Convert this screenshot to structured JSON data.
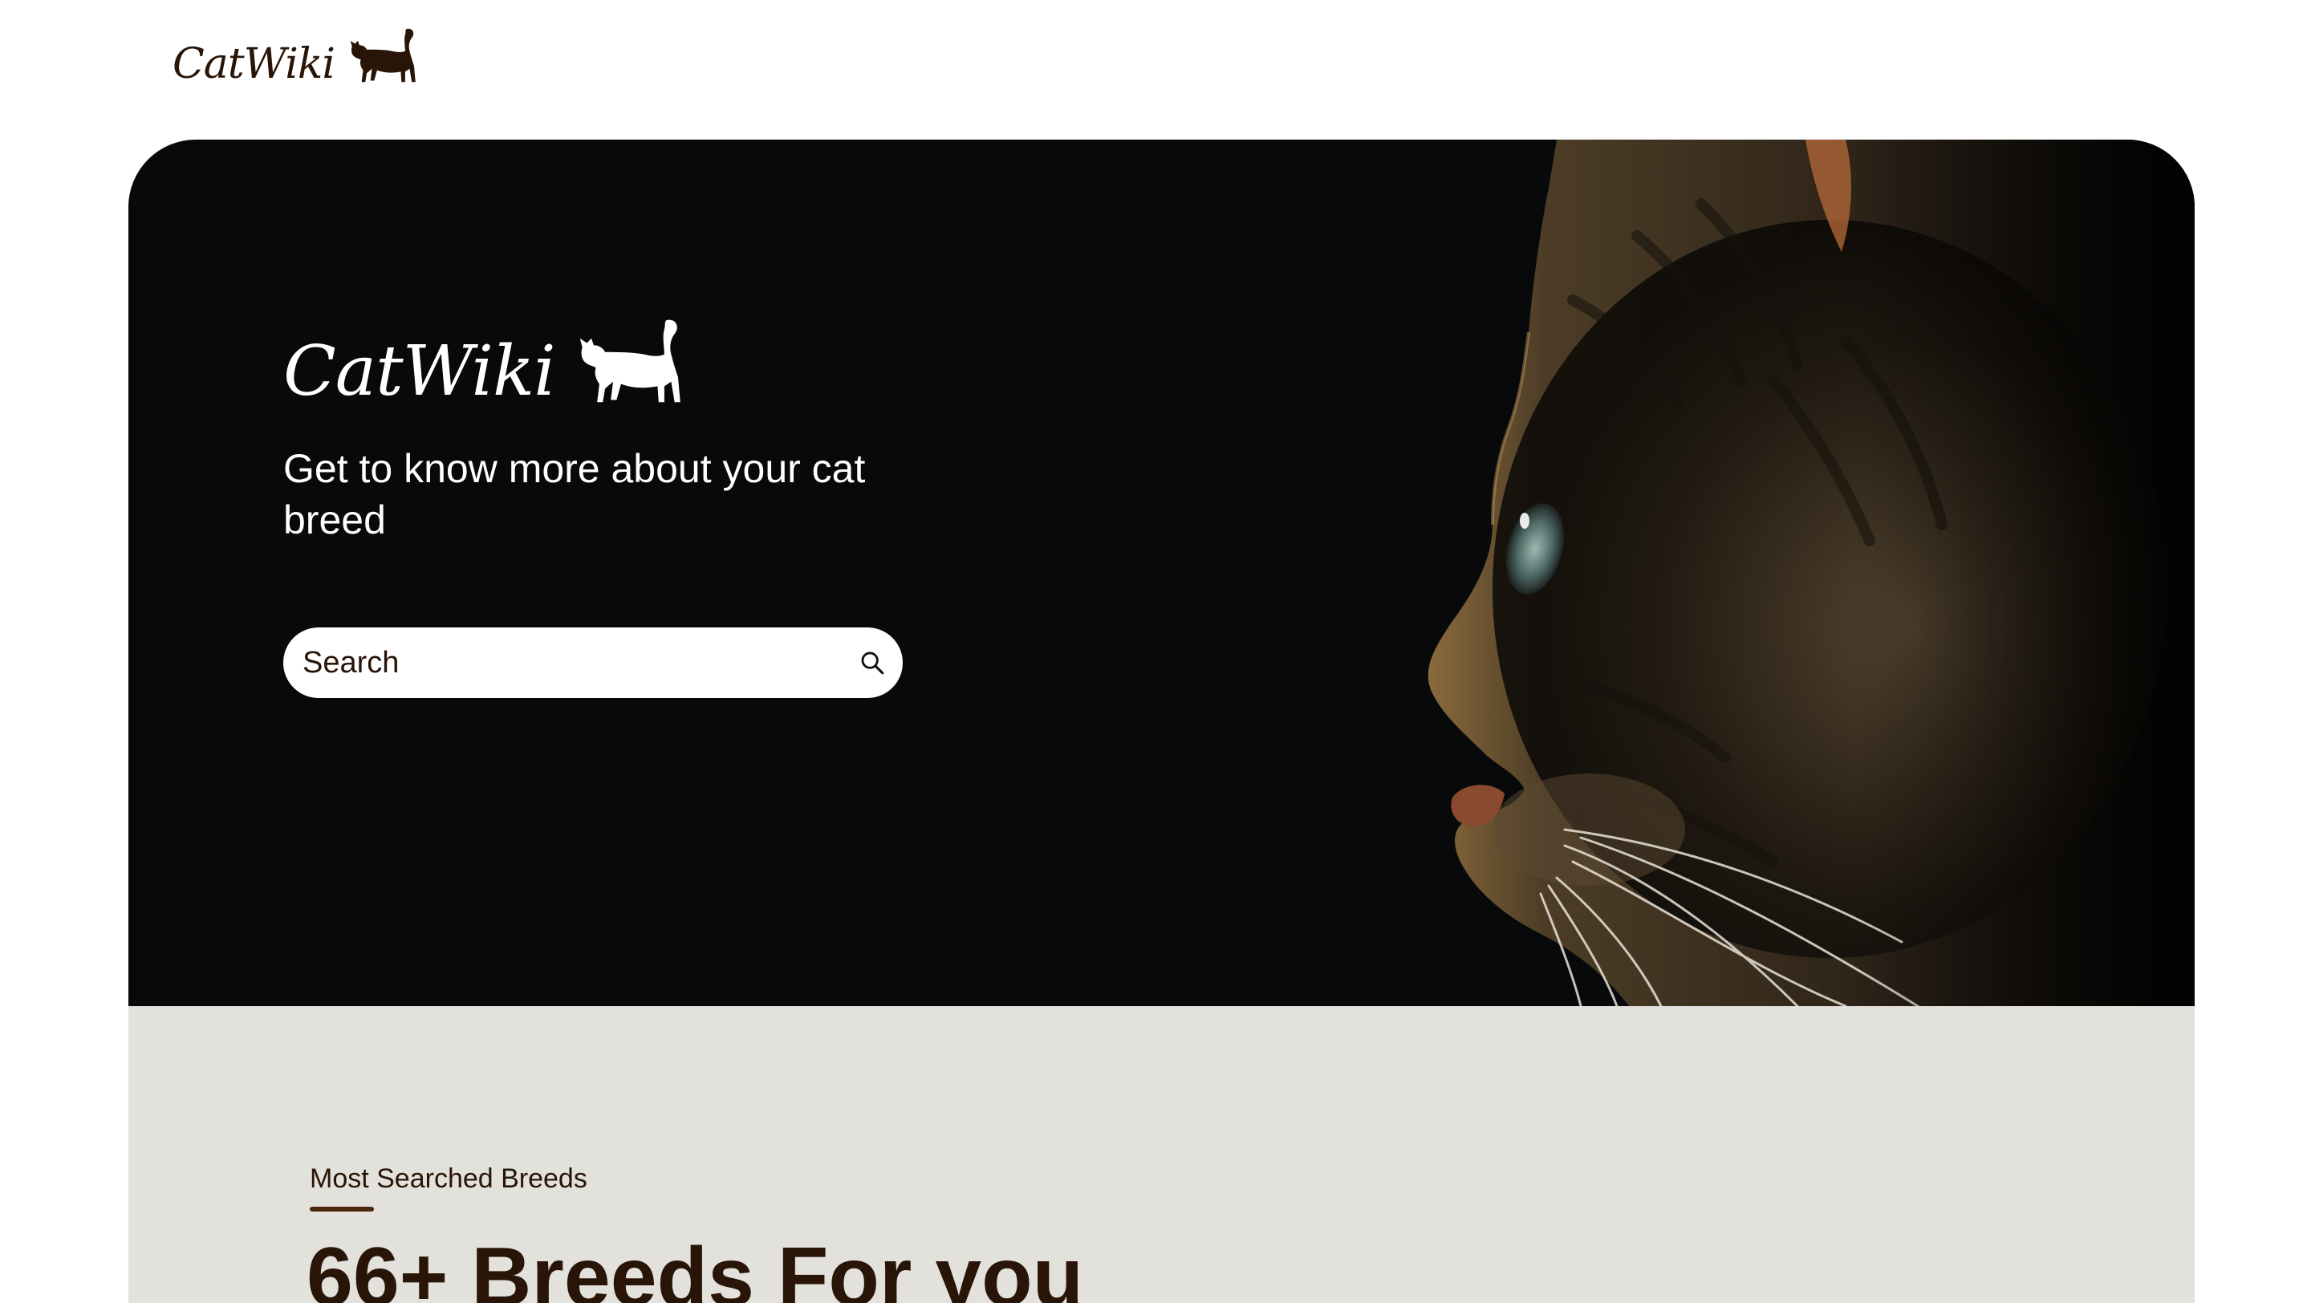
{
  "header": {
    "logo_text": "CatWiki"
  },
  "hero": {
    "logo_text": "CatWiki",
    "tagline": "Get to know more about your cat breed",
    "search": {
      "placeholder": "Search",
      "icon": "search-icon"
    }
  },
  "breeds_section": {
    "label": "Most Searched Breeds",
    "heading": "66+ Breeds For you"
  },
  "colors": {
    "brand_brown": "#291507",
    "accent_brown": "#4d270c",
    "hero_background": "#07090b",
    "section_background": "#e3e1dc"
  }
}
